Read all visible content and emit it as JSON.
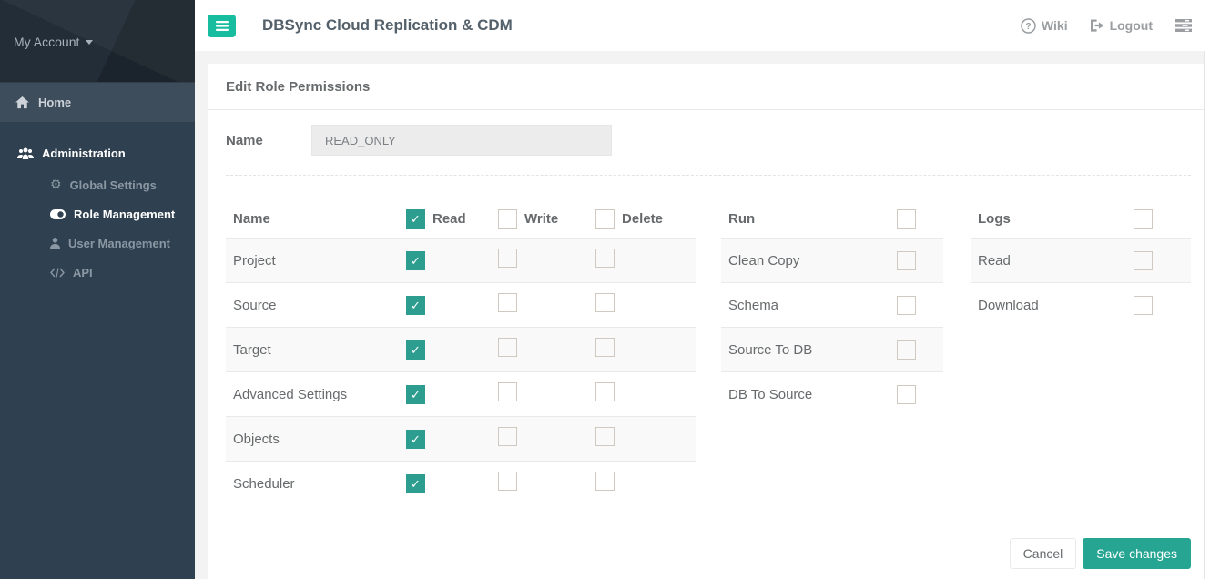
{
  "topbar": {
    "title": "DBSync Cloud Replication & CDM",
    "wiki_label": "Wiki",
    "logout_label": "Logout"
  },
  "sidebar": {
    "account_label": "My Account",
    "home_label": "Home",
    "administration_label": "Administration",
    "items": [
      {
        "label": "Global Settings",
        "active": false
      },
      {
        "label": "Role Management",
        "active": true
      },
      {
        "label": "User Management",
        "active": false
      },
      {
        "label": "API",
        "active": false
      }
    ]
  },
  "panel": {
    "title": "Edit Role Permissions",
    "name_label": "Name",
    "name_value": "READ_ONLY"
  },
  "permissions": {
    "headers": {
      "name": "Name",
      "read": "Read",
      "write": "Write",
      "delete": "Delete"
    },
    "header_checks": {
      "read": true,
      "write": false,
      "delete": false
    },
    "rows": [
      {
        "name": "Project",
        "read": true,
        "write": false,
        "delete": false
      },
      {
        "name": "Source",
        "read": true,
        "write": false,
        "delete": false
      },
      {
        "name": "Target",
        "read": true,
        "write": false,
        "delete": false
      },
      {
        "name": "Advanced Settings",
        "read": true,
        "write": false,
        "delete": false
      },
      {
        "name": "Objects",
        "read": true,
        "write": false,
        "delete": false
      },
      {
        "name": "Scheduler",
        "read": true,
        "write": false,
        "delete": false
      }
    ]
  },
  "run": {
    "header": "Run",
    "header_checked": false,
    "rows": [
      {
        "name": "Clean Copy",
        "checked": false
      },
      {
        "name": "Schema",
        "checked": false
      },
      {
        "name": "Source To DB",
        "checked": false
      },
      {
        "name": "DB To Source",
        "checked": false
      }
    ]
  },
  "logs": {
    "header": "Logs",
    "header_checked": false,
    "rows": [
      {
        "name": "Read",
        "checked": false
      },
      {
        "name": "Download",
        "checked": false
      }
    ]
  },
  "footer": {
    "cancel_label": "Cancel",
    "save_label": "Save changes"
  },
  "colors": {
    "accent_green": "#17bd9e",
    "check_green": "#2d9d8f",
    "save_green": "#27a593",
    "sidebar_bg": "#2f4050",
    "sidebar_header_bg": "#222d38",
    "page_bg": "#f3f3f4",
    "stripe": "#f9f9f9",
    "border": "#e7eaec"
  }
}
